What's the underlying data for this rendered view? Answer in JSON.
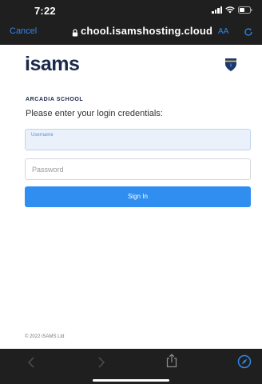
{
  "status_bar": {
    "time": "7:22",
    "icons": [
      "signal-icon",
      "wifi-icon",
      "battery-icon"
    ]
  },
  "browser": {
    "cancel_label": "Cancel",
    "url": "chool.isamshosting.cloud",
    "text_size_label": "AA",
    "icons": [
      "lock-icon",
      "reload-icon"
    ],
    "accent_color": "#2f86e8"
  },
  "login": {
    "logo": "isams",
    "school_name": "ARCADIA SCHOOL",
    "prompt": "Please enter your login credentials:",
    "username_label": "Username",
    "password_placeholder": "Password",
    "signin_label": "Sign In",
    "button_color": "#2f8ef0"
  },
  "footer": {
    "copyright": "© 2022 iSAMS Ltd"
  },
  "toolbar": {
    "icons": [
      "back-icon",
      "forward-icon",
      "share-icon",
      "compass-icon"
    ]
  }
}
